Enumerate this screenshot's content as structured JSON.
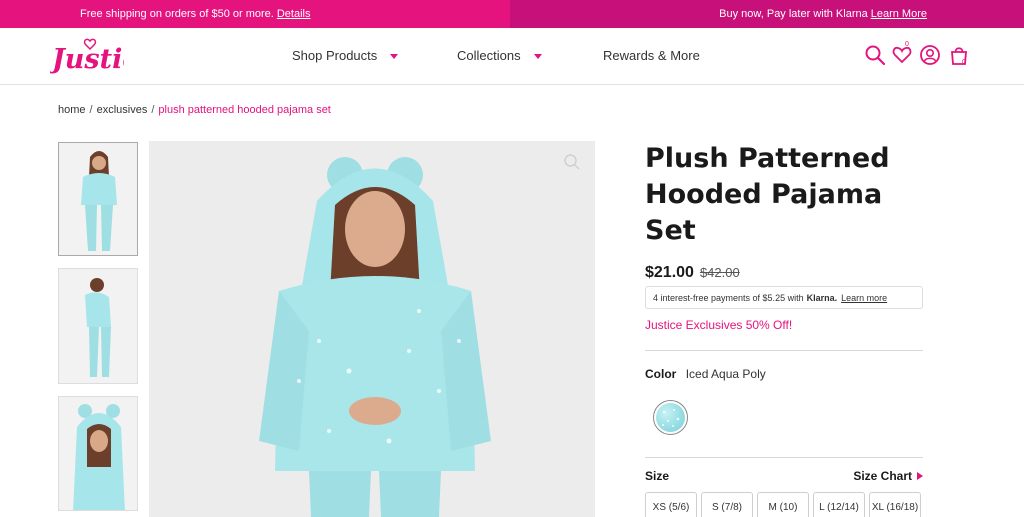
{
  "promo": {
    "left_text": "Free shipping on orders of $50 or more.",
    "left_link": "Details",
    "right_text": "Buy now, Pay later with Klarna",
    "right_link": "Learn More"
  },
  "header": {
    "logo_text": "Justice",
    "nav": [
      {
        "label": "Shop Products",
        "has_caret": true
      },
      {
        "label": "Collections",
        "has_caret": true
      },
      {
        "label": "Rewards & More",
        "has_caret": false
      }
    ],
    "icons": [
      "search-icon",
      "wishlist-icon",
      "account-icon",
      "cart-icon"
    ],
    "wishlist_count": "0",
    "cart_count": "0"
  },
  "breadcrumb": {
    "items": [
      "home",
      "exclusives"
    ],
    "separator": "/",
    "current": "plush patterned hooded pajama set"
  },
  "product": {
    "title": "Plush Patterned Hooded Pajama Set",
    "price_now": "$21.00",
    "price_was": "$42.00",
    "klarna": {
      "text": "4 interest-free payments of $5.25 with",
      "brand": "Klarna.",
      "link": "Learn more"
    },
    "promo": "Justice Exclusives 50% Off!",
    "color_label": "Color",
    "color_value": "Iced Aqua Poly",
    "size_label": "Size",
    "size_chart_label": "Size Chart",
    "sizes": [
      "XS (5/6)",
      "S (7/8)",
      "M (10)",
      "L (12/14)",
      "XL (16/18)"
    ]
  },
  "colors": {
    "brand_pink": "#e4137e",
    "promo_right": "#c8107a",
    "aqua": "#9fe2e7"
  }
}
